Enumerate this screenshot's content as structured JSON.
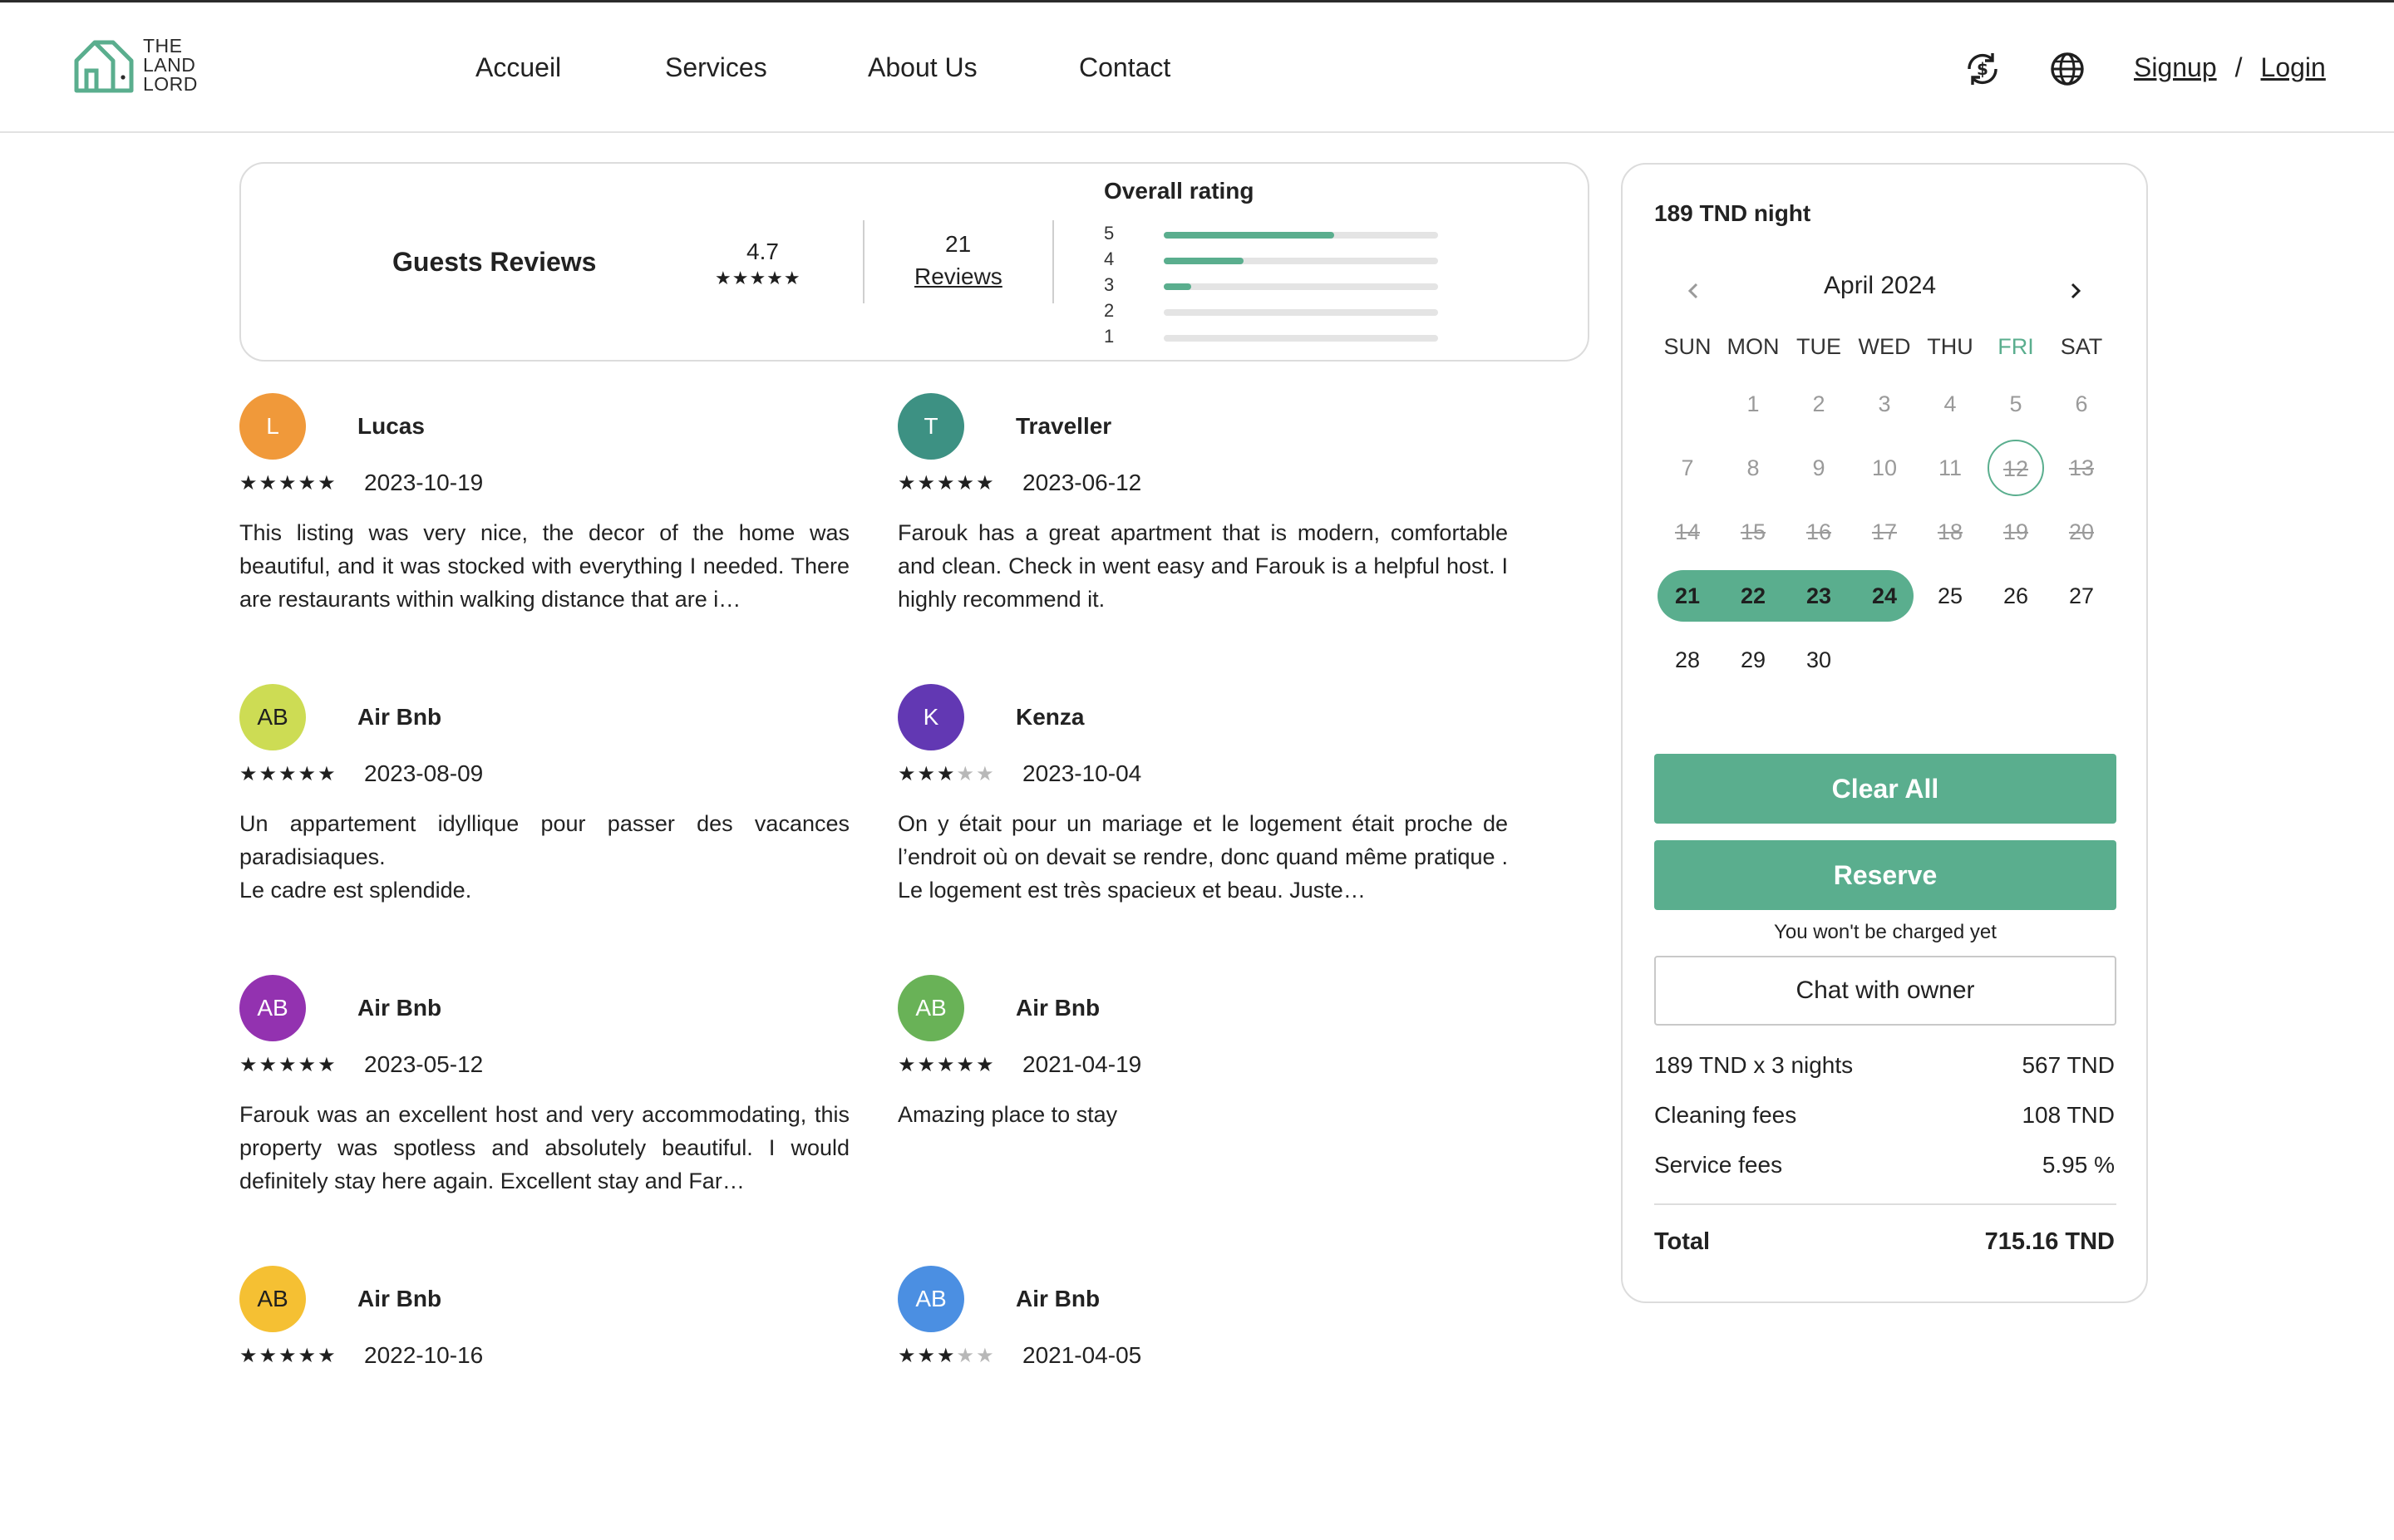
{
  "header": {
    "logo_text": [
      "THE",
      "LAND",
      "LORD"
    ],
    "nav": [
      "Accueil",
      "Services",
      "About Us",
      "Contact"
    ],
    "icons": [
      "currency-exchange-icon",
      "globe-icon"
    ],
    "signup": "Signup",
    "separator": "/",
    "login": "Login"
  },
  "summary": {
    "title": "Guests Reviews",
    "average": "4.7",
    "average_stars": "★★★★★",
    "count": "21",
    "count_label": "Reviews",
    "overall_title": "Overall rating",
    "distribution": [
      {
        "label": "5",
        "fraction": 0.62
      },
      {
        "label": "4",
        "fraction": 0.29
      },
      {
        "label": "3",
        "fraction": 0.1
      },
      {
        "label": "2",
        "fraction": 0.0
      },
      {
        "label": "1",
        "fraction": 0.0
      }
    ]
  },
  "reviews": [
    {
      "initials": "L",
      "name": "Lucas",
      "rating": 5,
      "date": "2023-10-19",
      "avatar_color": "#f0993a",
      "text": "This listing was very nice, the decor of the home was beautiful, and it was stocked with everything I needed. There are restaurants within walking distance that are i…"
    },
    {
      "initials": "T",
      "name": "Traveller",
      "rating": 5,
      "date": "2023-06-12",
      "avatar_color": "#3d9183",
      "text": "Farouk has a great apartment that is modern, comfortable and clean. Check in went easy and Farouk is a helpful host. I highly recommend it."
    },
    {
      "initials": "AB",
      "name": "Air Bnb",
      "rating": 5,
      "date": "2023-08-09",
      "avatar_color": "#cddc54",
      "text": "Un appartement idyllique pour passer des vacances paradisiaques.\nLe cadre est splendide."
    },
    {
      "initials": "K",
      "name": "Kenza",
      "rating": 3,
      "date": "2023-10-04",
      "avatar_color": "#6238b3",
      "text": "On y était pour un mariage et le logement était proche de l’endroit où on devait se rendre, donc quand même pratique . Le logement est très spacieux et beau. Juste…"
    },
    {
      "initials": "AB",
      "name": "Air Bnb",
      "rating": 5,
      "date": "2023-05-12",
      "avatar_color": "#9332b0",
      "text": "Farouk was an excellent host and very accommodating, this property was spotless and absolutely beautiful. I would definitely stay here again. Excellent stay and Far…"
    },
    {
      "initials": "AB",
      "name": "Air Bnb",
      "rating": 5,
      "date": "2021-04-19",
      "avatar_color": "#69b257",
      "text": "Amazing place to  stay"
    },
    {
      "initials": "AB",
      "name": "Air Bnb",
      "rating": 5,
      "date": "2022-10-16",
      "avatar_color": "#f5c033",
      "text": ""
    },
    {
      "initials": "AB",
      "name": "Air Bnb",
      "rating": 3,
      "date": "2021-04-05",
      "avatar_color": "#4b8fe2",
      "text": ""
    }
  ],
  "booking": {
    "price_night": "189 TND night",
    "month": "April 2024",
    "weekdays": [
      "SUN",
      "MON",
      "TUE",
      "WED",
      "THU",
      "FRI",
      "SAT"
    ],
    "today_weekday_index": 5,
    "first_weekday_index": 1,
    "days_in_month": 30,
    "past_until": 11,
    "today": 12,
    "booked": [
      13,
      14,
      15,
      16,
      17,
      18,
      19,
      20
    ],
    "selected": [
      21,
      22,
      23,
      24
    ],
    "clear_label": "Clear All",
    "reserve_label": "Reserve",
    "no_charge_note": "You won't be charged yet",
    "chat_label": "Chat with owner",
    "fees": [
      {
        "label": "189 TND x 3 nights",
        "value": "567 TND"
      },
      {
        "label": "Cleaning fees",
        "value": "108 TND"
      },
      {
        "label": "Service fees",
        "value": "5.95 %"
      }
    ],
    "total_label": "Total",
    "total_value": "715.16 TND"
  },
  "colors": {
    "accent": "#5aae8e",
    "border": "#dcdcdc",
    "text": "#1f1f1f"
  }
}
